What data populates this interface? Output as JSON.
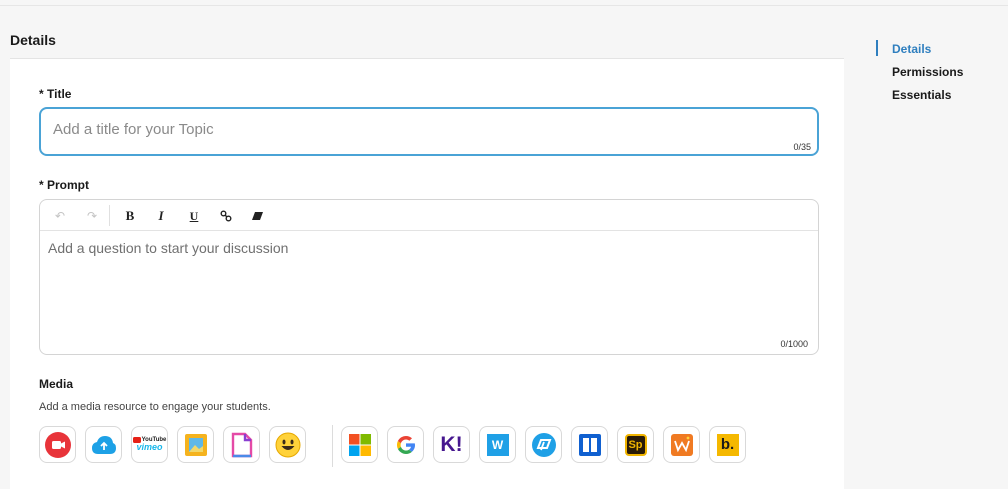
{
  "section": {
    "heading": "Details"
  },
  "title_field": {
    "label": "* Title",
    "placeholder": "Add a title for your Topic",
    "value": "",
    "counter": "0/35"
  },
  "prompt_field": {
    "label": "* Prompt",
    "placeholder": "Add a question to start your discussion",
    "counter": "0/1000"
  },
  "toolbar": {
    "undo_glyph": "↶",
    "redo_glyph": "↷",
    "bold": "B",
    "italic": "I",
    "underline": "U",
    "link_glyph": "🔗",
    "clear_glyph": "⌫"
  },
  "media": {
    "title": "Media",
    "subtitle": "Add a media resource to engage your students.",
    "youtube_label": "YouTube",
    "vimeo_label": "vimeo",
    "kahoot_label": "K!",
    "wakelet_label": "W",
    "sp_label": "Sp",
    "b_label": "b."
  },
  "nav": {
    "items": [
      "Details",
      "Permissions",
      "Essentials"
    ],
    "active": "Details"
  },
  "colors": {
    "accent": "#2f7fbf",
    "input_focus": "#4aa3d6",
    "record_red": "#e8343a",
    "upload_blue": "#1da1e6"
  }
}
